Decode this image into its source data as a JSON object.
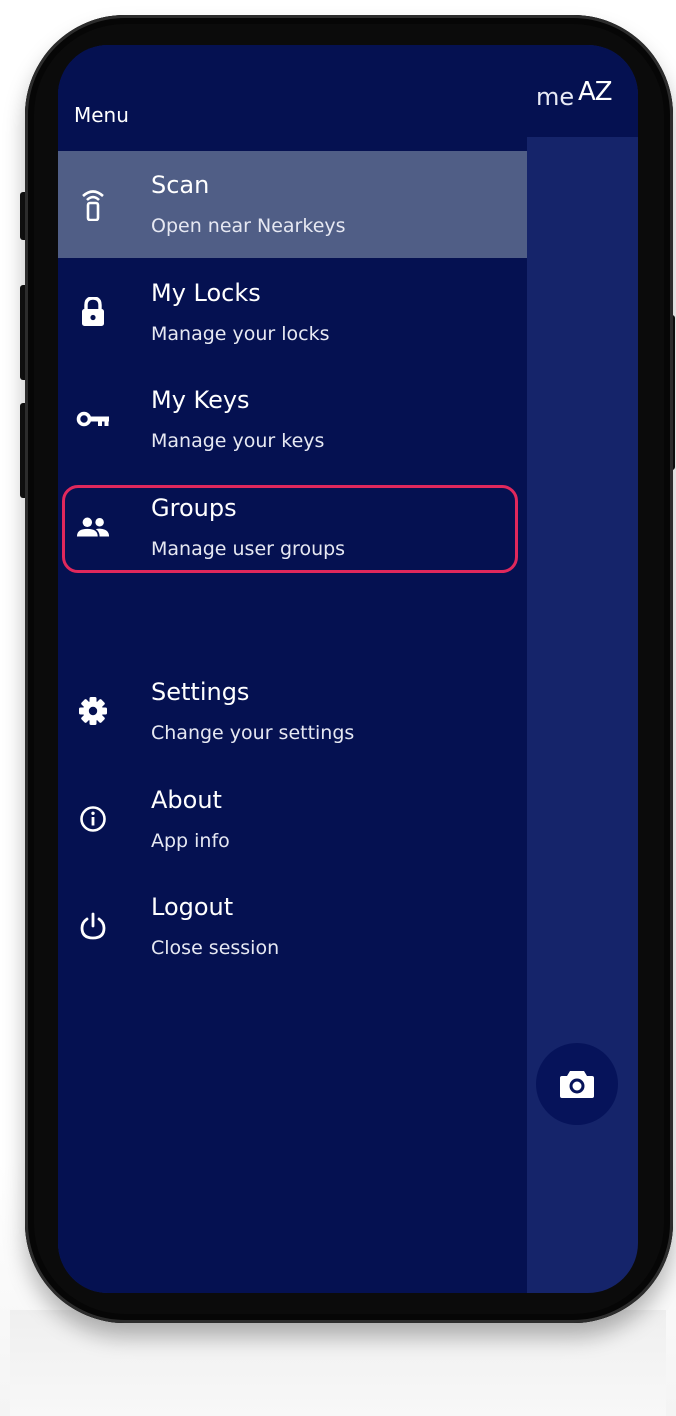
{
  "drawer": {
    "title": "Menu",
    "items": [
      {
        "label": "Scan",
        "sublabel": "Open near Nearkeys",
        "icon": "remote-icon",
        "active": true
      },
      {
        "label": "My Locks",
        "sublabel": "Manage your locks",
        "icon": "lock-icon"
      },
      {
        "label": "My Keys",
        "sublabel": "Manage your keys",
        "icon": "key-icon"
      },
      {
        "label": "Groups",
        "sublabel": "Manage user groups",
        "icon": "group-icon",
        "highlighted": true
      },
      {
        "label": "Settings",
        "sublabel": "Change your settings",
        "icon": "gear-icon"
      },
      {
        "label": "About",
        "sublabel": "App info",
        "icon": "info-icon"
      },
      {
        "label": "Logout",
        "sublabel": "Close session",
        "icon": "power-icon"
      }
    ]
  },
  "background": {
    "header_partial_text": "me",
    "sort_label": "AZ",
    "fab_icon": "camera-icon"
  },
  "colors": {
    "drawer_bg": "#051151",
    "active_item_bg": "#505e86",
    "highlight_border": "#e0285c",
    "app_bg": "#15246a"
  }
}
